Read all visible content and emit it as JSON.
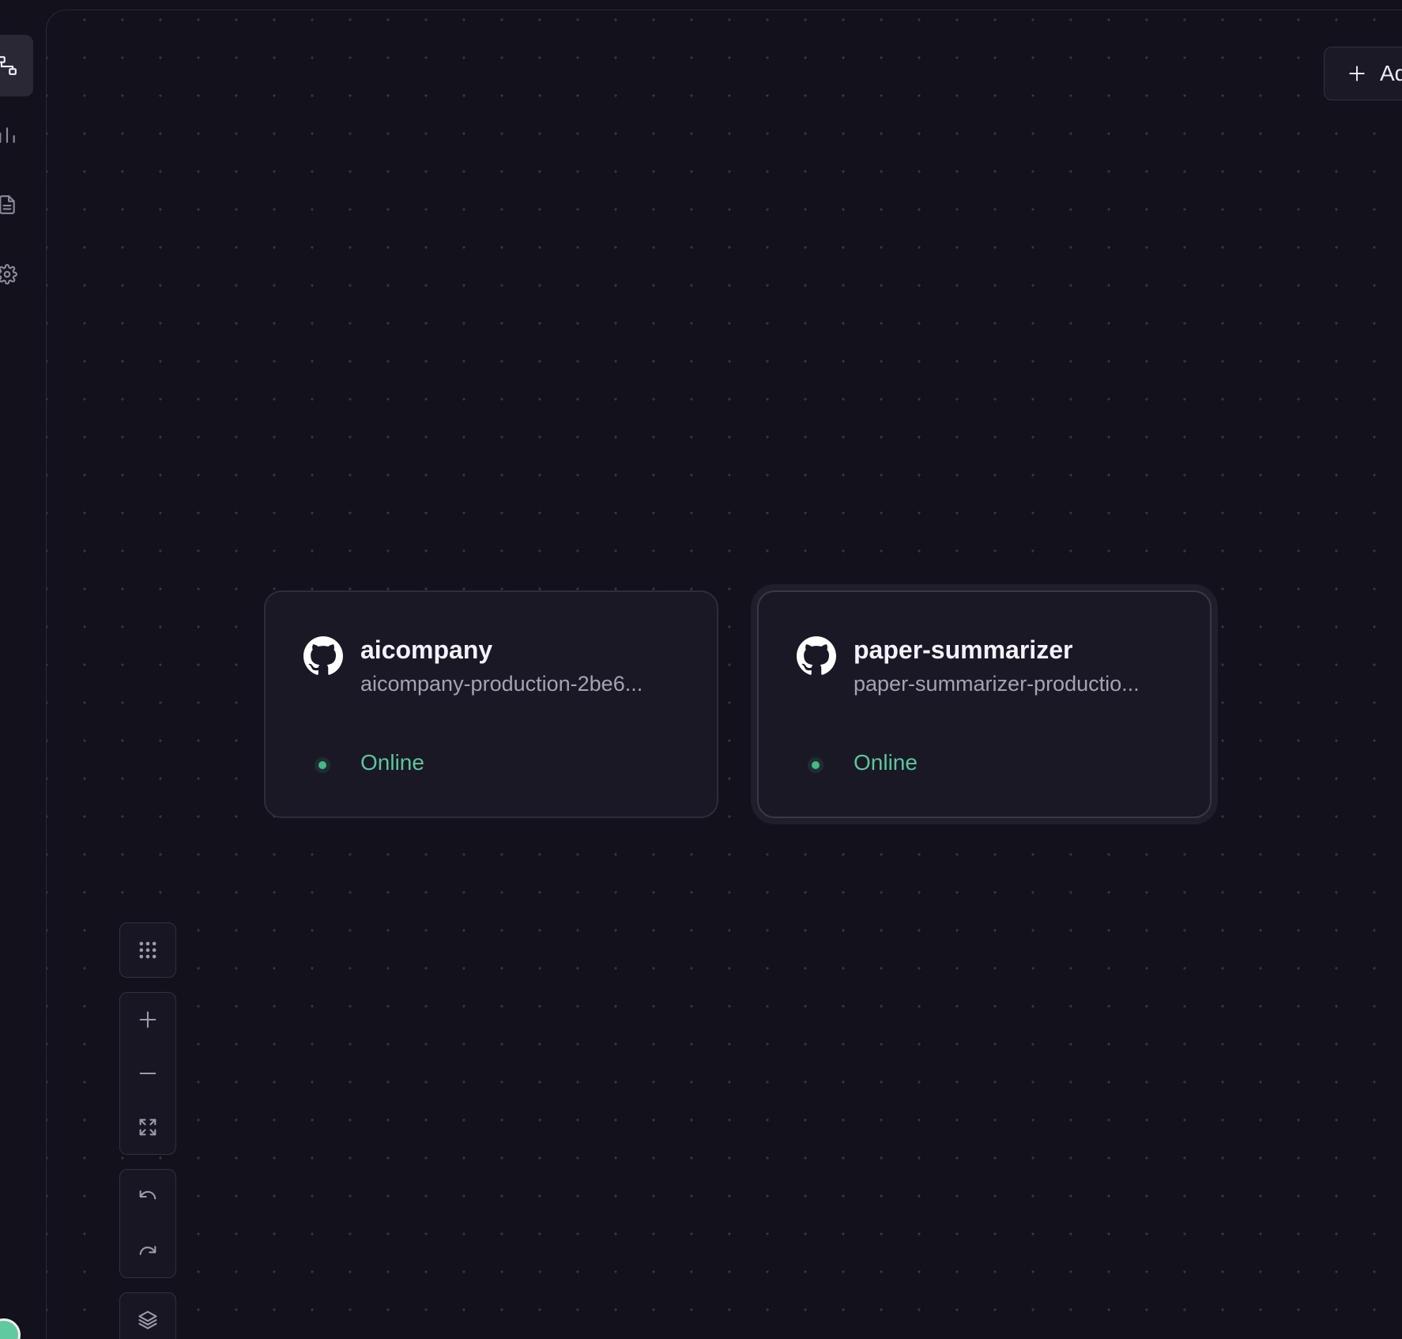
{
  "sidebar": {
    "items": [
      {
        "icon": "architecture-icon",
        "active": true
      },
      {
        "icon": "metrics-icon",
        "active": false
      },
      {
        "icon": "logs-icon",
        "active": false
      },
      {
        "icon": "settings-icon",
        "active": false
      }
    ]
  },
  "toolbar": {
    "add_label": "Add"
  },
  "services": [
    {
      "name": "aicompany",
      "domain": "aicompany-production-2be6...",
      "status": "Online",
      "icon": "github-icon",
      "selected": false
    },
    {
      "name": "paper-summarizer",
      "domain": "paper-summarizer-productio...",
      "status": "Online",
      "icon": "github-icon",
      "selected": true
    }
  ],
  "canvas_controls": {
    "groups": [
      [
        "grid-icon"
      ],
      [
        "zoom-in-icon",
        "zoom-out-icon",
        "fit-view-icon"
      ],
      [
        "undo-icon",
        "redo-icon"
      ],
      [
        "layers-icon"
      ]
    ]
  },
  "colors": {
    "background": "#13111c",
    "card": "#1a1824",
    "status_online": "#43b985"
  }
}
